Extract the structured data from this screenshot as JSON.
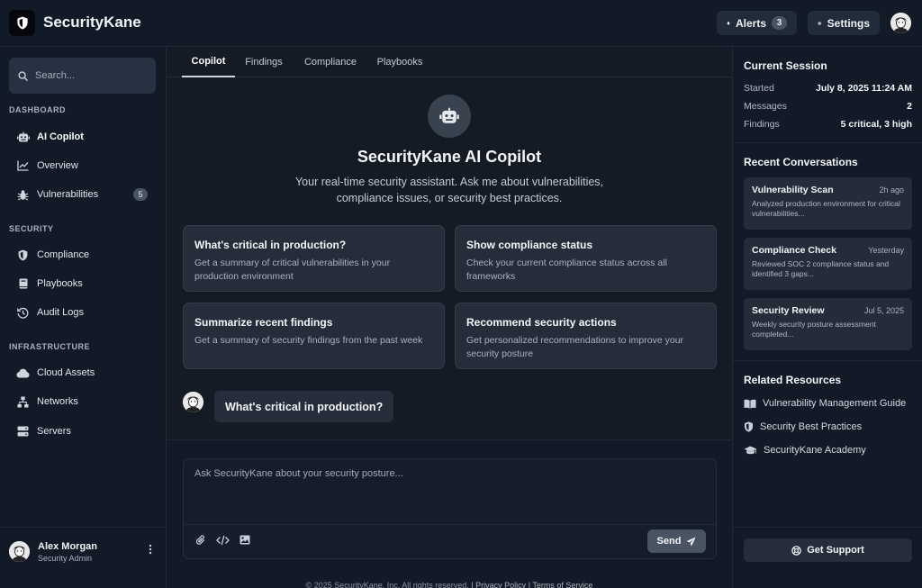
{
  "app": {
    "title": "SecurityKane"
  },
  "header": {
    "alerts_label": "Alerts",
    "alerts_count": "3",
    "settings_label": "Settings"
  },
  "sidebar": {
    "search_placeholder": "Search...",
    "sections": {
      "dashboard": "DASHBOARD",
      "security": "SECURITY",
      "infrastructure": "INFRASTRUCTURE"
    },
    "items": [
      {
        "label": "AI Copilot",
        "icon": "robot-icon",
        "active": true
      },
      {
        "label": "Overview",
        "icon": "chart-line-icon"
      },
      {
        "label": "Vulnerabilities",
        "icon": "bug-icon",
        "badge": "5"
      },
      {
        "label": "Compliance",
        "icon": "shield-icon"
      },
      {
        "label": "Playbooks",
        "icon": "book-icon"
      },
      {
        "label": "Audit Logs",
        "icon": "history-icon"
      },
      {
        "label": "Cloud Assets",
        "icon": "cloud-icon"
      },
      {
        "label": "Networks",
        "icon": "network-icon"
      },
      {
        "label": "Servers",
        "icon": "server-icon"
      }
    ],
    "user": {
      "name": "Alex Morgan",
      "role": "Security Admin"
    }
  },
  "main": {
    "tabs": [
      "Copilot",
      "Findings",
      "Compliance",
      "Playbooks"
    ],
    "active_tab": "Copilot",
    "copilot_title": "SecurityKane AI Copilot",
    "copilot_description": "Your real-time security assistant. Ask me about vulnerabilities, compliance issues, or security best practices.",
    "suggestions": [
      {
        "title": "What's critical in production?",
        "description": "Get a summary of critical vulnerabilities in your production environment"
      },
      {
        "title": "Show compliance status",
        "description": "Check your current compliance status across all frameworks"
      },
      {
        "title": "Summarize recent findings",
        "description": "Get a summary of security findings from the past week"
      },
      {
        "title": "Recommend security actions",
        "description": "Get personalized recommendations to improve your security posture"
      }
    ],
    "user_message": "What's critical in production?",
    "composer_placeholder": "Ask SecurityKane about your security posture...",
    "send_label": "Send",
    "footer": {
      "copyright": "© 2025 SecurityKane, Inc. All rights reserved.",
      "privacy": "Privacy Policy",
      "terms": "Terms of Service"
    }
  },
  "right_panel": {
    "session_heading": "Current Session",
    "session": [
      {
        "key": "Started",
        "value": "July 8, 2025 11:24 AM"
      },
      {
        "key": "Messages",
        "value": "2"
      },
      {
        "key": "Findings",
        "value": "5 critical, 3 high"
      }
    ],
    "recent_heading": "Recent Conversations",
    "conversations": [
      {
        "title": "Vulnerability Scan",
        "time": "2h ago",
        "description": "Analyzed production environment for critical vulnerabilities..."
      },
      {
        "title": "Compliance Check",
        "time": "Yesterday",
        "description": "Reviewed SOC 2 compliance status and identified 3 gaps..."
      },
      {
        "title": "Security Review",
        "time": "Jul 5, 2025",
        "description": "Weekly security posture assessment completed..."
      }
    ],
    "resources_heading": "Related Resources",
    "resources": [
      {
        "label": "Vulnerability Management Guide",
        "icon": "book-open-icon"
      },
      {
        "label": "Security Best Practices",
        "icon": "shield-icon"
      },
      {
        "label": "SecurityKane Academy",
        "icon": "graduation-cap-icon"
      }
    ],
    "support_label": "Get Support"
  }
}
